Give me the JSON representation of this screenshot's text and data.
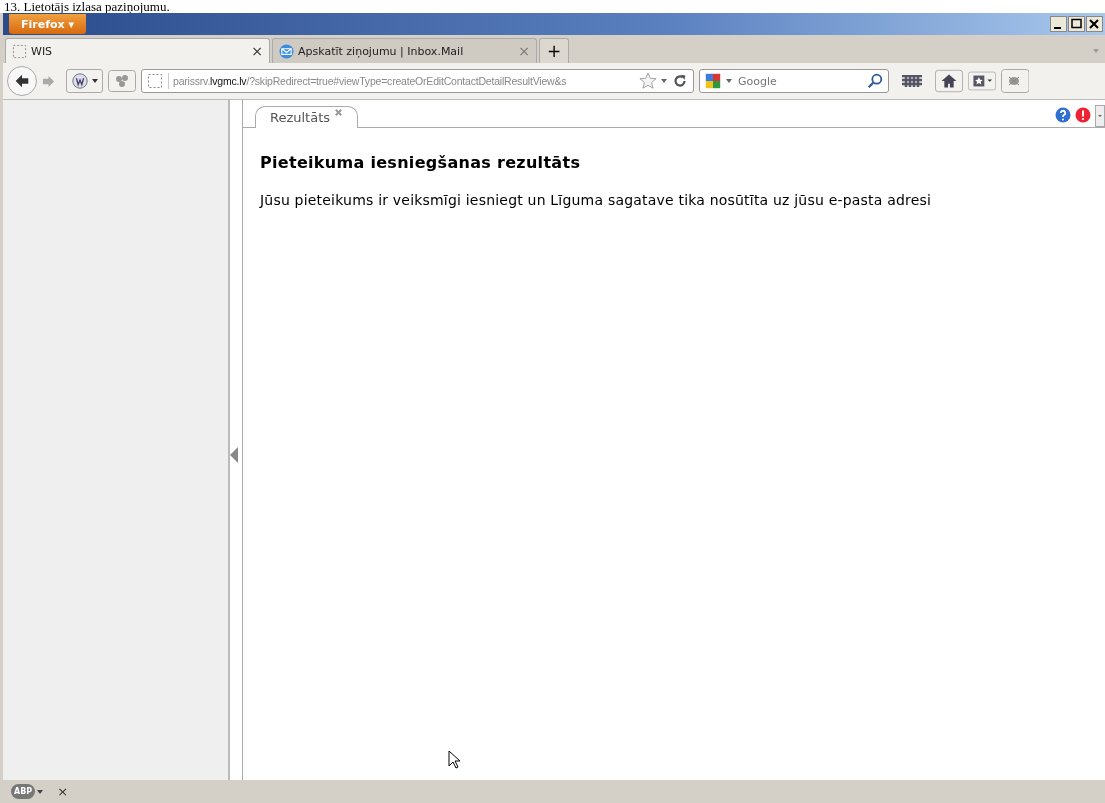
{
  "caption": "13. Lietotājs izlasa paziņojumu.",
  "window": {
    "app_button": "Firefox ▾"
  },
  "tabs": [
    {
      "title": "WIS",
      "selected": true,
      "close": "×"
    },
    {
      "title": "Apskatīt ziņojumu | Inbox.Mail",
      "selected": false,
      "close": "×"
    }
  ],
  "new_tab": "+",
  "address_bar": {
    "value": "parissrv.**lvgmc.lv**/?skipRedirect=true#viewType=createOrEditContactDetailResultView&s"
  },
  "search": {
    "placeholder": "Google"
  },
  "page_tabs": [
    {
      "title": "Rezultāts",
      "selected": true
    }
  ],
  "content": {
    "heading": "Pieteikuma iesniegšanas rezultāts",
    "message": "Jūsu pieteikums ir veiksmīgi iesniegt un Līguma sagatave tika nosūtīta uz jūsu e-pasta adresi"
  },
  "status_bar": {
    "addon": "ABP",
    "close": "×"
  }
}
